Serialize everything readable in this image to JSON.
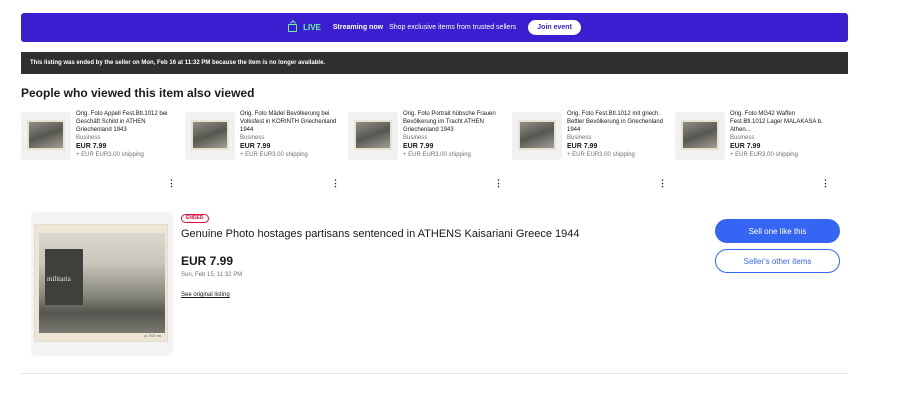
{
  "live_banner": {
    "live_label": "LIVE",
    "streaming_label": "Streaming now",
    "message": "Shop exclusive items from trusted sellers",
    "join_button": "Join event",
    "accent_color": "#6cf7a0",
    "background_color": "#3b1ecf"
  },
  "ended_notice": "This listing was ended by the seller on Mon, Feb 16 at 11:32 PM because the item is no longer available.",
  "recommendations": {
    "title": "People who viewed this item also viewed",
    "items": [
      {
        "title": "Orig. Foto Appell Fest.Btl.1012 bei Geschäft Schild in ATHEN Griechenland 1943",
        "condition": "Business",
        "price": "EUR 7.99",
        "shipping": "+ EUR EUR3.00 shipping",
        "more_icon": "more-vertical-icon"
      },
      {
        "title": "Orig. Foto Mädel Bevölkerung bei Volksfest in KORINTH Griechenland 1944",
        "condition": "Business",
        "price": "EUR 7.99",
        "shipping": "+ EUR EUR3.00 shipping",
        "more_icon": "more-vertical-icon"
      },
      {
        "title": "Orig. Foto Portrait hübsche Frauen Bevölkerung im Tracht ATHEN Griechenland 1943",
        "condition": "Business",
        "price": "EUR 7.99",
        "shipping": "+ EUR EUR3.00 shipping",
        "more_icon": "more-vertical-icon"
      },
      {
        "title": "Orig. Foto Fest.Btl.1012 mit griech. Bettler Bevölkerung in Griechenland 1944",
        "condition": "Business",
        "price": "EUR 7.99",
        "shipping": "+ EUR EUR3.00 shipping",
        "more_icon": "more-vertical-icon"
      },
      {
        "title": "Orig. Foto MG42 Waffen Fest.Btl.1012 Lager MALAKASA b. Athen...",
        "condition": "Business",
        "price": "EUR 7.99",
        "shipping": "+ EUR EUR3.00 shipping",
        "more_icon": "more-vertical-icon"
      }
    ]
  },
  "listing": {
    "status_badge": "ENDED",
    "title": "Genuine Photo hostages partisans sentenced in ATHENS Kaisariani Greece 1944",
    "price": "EUR 7.99",
    "date": "Sun, Feb 15, 11:32 PM",
    "original_link": "See original listing",
    "image_watermark": "militaria",
    "image_caption": "ca. 5x5 cm",
    "status_color": "#e0103a"
  },
  "actions": {
    "sell_one": "Sell one like this",
    "seller_items": "Seller's other items",
    "primary_color": "#3665f3"
  }
}
